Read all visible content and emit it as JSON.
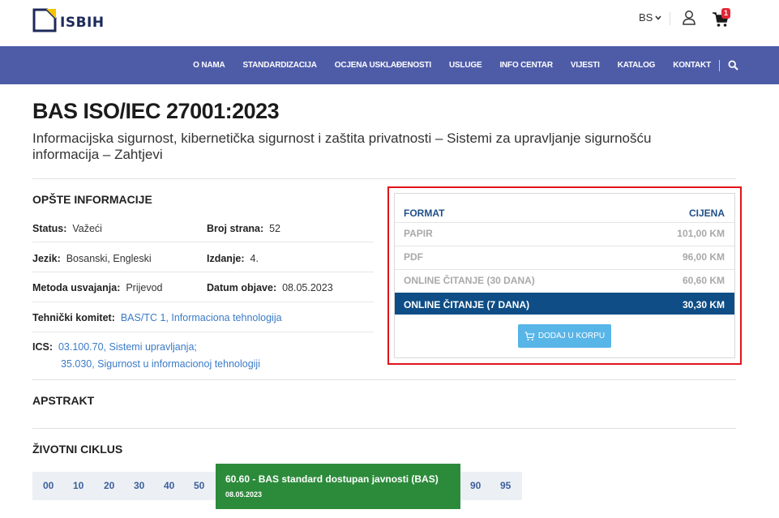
{
  "header": {
    "logo_text": "ISBIH",
    "language": "BS",
    "cart_count": "1"
  },
  "nav": {
    "items": [
      "O NAMA",
      "STANDARDIZACIJA",
      "OCJENA USKLAĐENOSTI",
      "USLUGE",
      "INFO CENTAR",
      "VIJESTI",
      "KATALOG",
      "KONTAKT"
    ]
  },
  "standard": {
    "code": "BAS ISO/IEC 27001:2023",
    "title": "Informacijska sigurnost, kibernetička sigurnost i zaštita privatnosti – Sistemi za upravljanje sigurnošću informacija – Zahtjevi"
  },
  "general": {
    "section_title": "OPŠTE INFORMACIJE",
    "status_label": "Status:",
    "status_value": "Važeći",
    "pages_label": "Broj strana:",
    "pages_value": "52",
    "language_label": "Jezik:",
    "language_value": "Bosanski, Engleski",
    "edition_label": "Izdanje:",
    "edition_value": "4.",
    "method_label": "Metoda usvajanja:",
    "method_value": "Prijevod",
    "date_label": "Datum objave:",
    "date_value": "08.05.2023",
    "committee_label": "Tehnički komitet:",
    "committee_value": "BAS/TC 1, Informaciona tehnologija",
    "ics_label": "ICS:",
    "ics_1": "03.100.70, Sistemi upravljanja;",
    "ics_2": "35.030, Sigurnost u informacionoj tehnologiji"
  },
  "pricing": {
    "format_header": "FORMAT",
    "price_header": "CIJENA",
    "rows": [
      {
        "format": "PAPIR",
        "price": "101,00 KM"
      },
      {
        "format": "PDF",
        "price": "96,00 KM"
      },
      {
        "format": "ONLINE ČITANJE (30 DANA)",
        "price": "60,60 KM"
      },
      {
        "format": "ONLINE ČITANJE (7 DANA)",
        "price": "30,30 KM"
      }
    ],
    "add_button": "DODAJ U KORPU"
  },
  "abstract": {
    "section_title": "APSTRAKT"
  },
  "lifecycle": {
    "section_title": "ŽIVOTNI CIKLUS",
    "stages": [
      "00",
      "10",
      "20",
      "30",
      "40",
      "50",
      "90",
      "95"
    ],
    "active_title": "60.60 - BAS standard dostupan javnosti (BAS)",
    "active_date": "08.05.2023"
  },
  "colors": {
    "nav_bg": "#4e5ca8",
    "selected_row": "#0e4d85",
    "highlight_border": "#e0121b",
    "lifecycle_active": "#2c8b3a",
    "add_button": "#58b5e8"
  }
}
